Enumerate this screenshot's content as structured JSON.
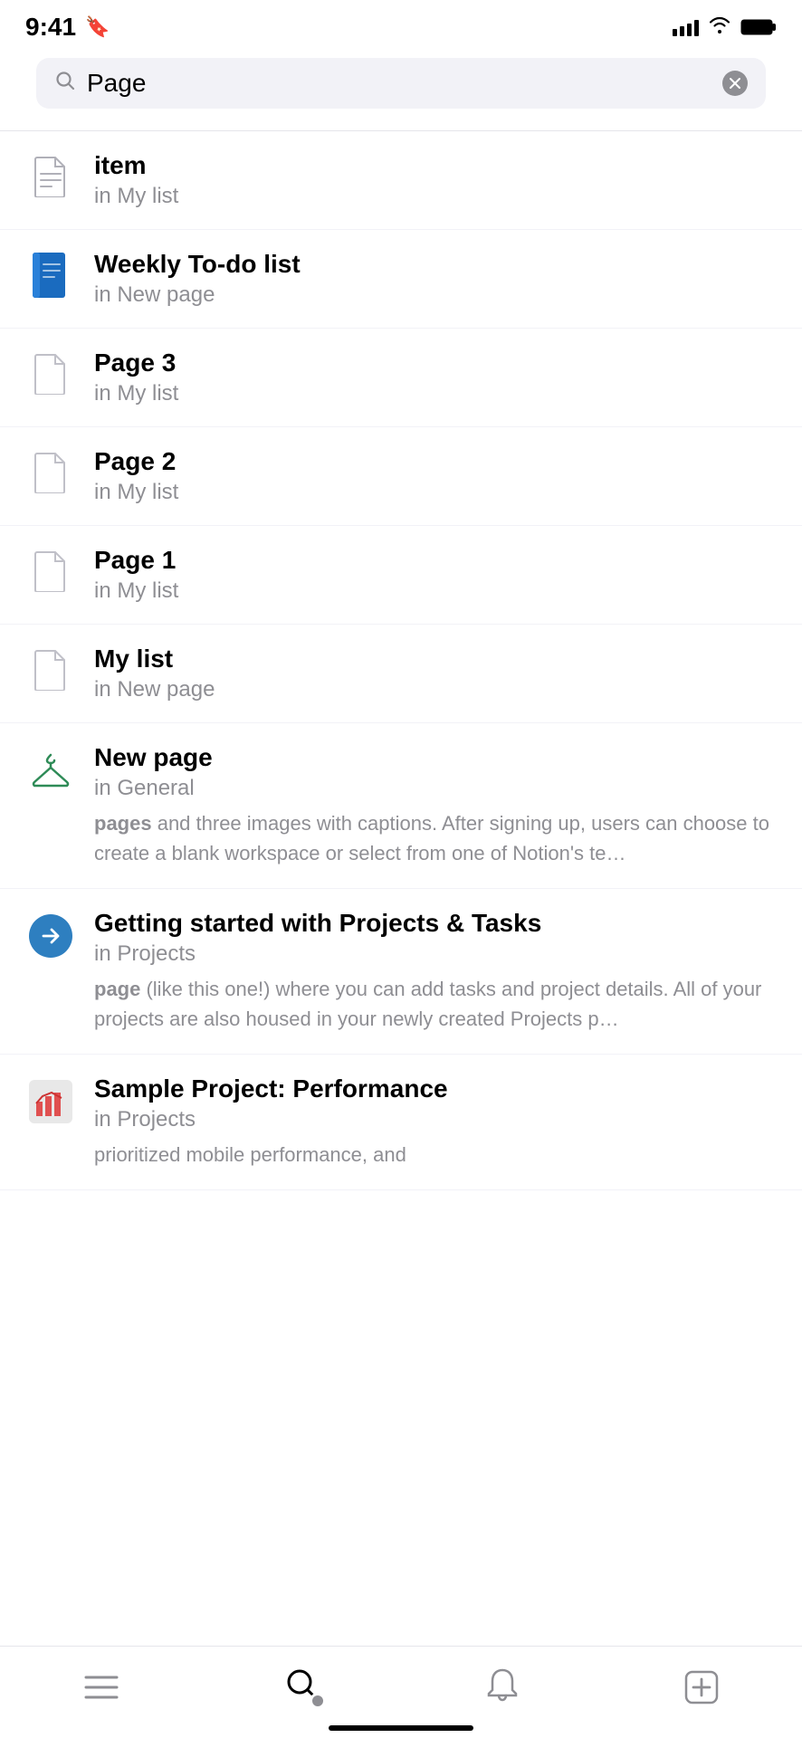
{
  "statusBar": {
    "time": "9:41",
    "icons": [
      "bookmark",
      "signal",
      "wifi",
      "battery"
    ]
  },
  "search": {
    "query": "Page",
    "placeholder": "Search"
  },
  "results": [
    {
      "id": "item-1",
      "title": "item",
      "subtitle": "in My list",
      "iconType": "document",
      "preview": null
    },
    {
      "id": "item-2",
      "title": "Weekly To-do list",
      "subtitle": "in New page",
      "iconType": "blue-book",
      "preview": null
    },
    {
      "id": "item-3",
      "title": "Page 3",
      "subtitle": "in My list",
      "iconType": "document",
      "preview": null
    },
    {
      "id": "item-4",
      "title": "Page 2",
      "subtitle": "in My list",
      "iconType": "document",
      "preview": null
    },
    {
      "id": "item-5",
      "title": "Page 1",
      "subtitle": "in My list",
      "iconType": "document",
      "preview": null
    },
    {
      "id": "item-6",
      "title": "My list",
      "subtitle": "in New page",
      "iconType": "document",
      "preview": null
    },
    {
      "id": "item-7",
      "title": "New page",
      "subtitle": "in General",
      "iconType": "hanger",
      "preview": "pages and three images with captions. After signing up, users can choose to create a blank workspace or select from one of Notion's te…",
      "previewHighlight": "pages"
    },
    {
      "id": "item-8",
      "title": "Getting started with Projects & Tasks",
      "subtitle": "in Projects",
      "iconType": "blue-arrow",
      "preview": "page (like this one!) where you can add tasks and project details. All of your projects are also housed in your newly created Projects p…",
      "previewHighlight": "page"
    },
    {
      "id": "item-9",
      "title": "Sample Project: Performance",
      "subtitle": "in Projects",
      "iconType": "chart",
      "preview": "prioritized mobile performance, and",
      "previewHighlight": null
    }
  ],
  "tabBar": {
    "items": [
      {
        "id": "tab-inbox",
        "label": "Inbox",
        "icon": "list-icon"
      },
      {
        "id": "tab-search",
        "label": "Search",
        "icon": "search-icon",
        "active": true
      },
      {
        "id": "tab-notifications",
        "label": "Notifications",
        "icon": "bell-icon"
      },
      {
        "id": "tab-new",
        "label": "New",
        "icon": "plus-icon"
      }
    ]
  }
}
